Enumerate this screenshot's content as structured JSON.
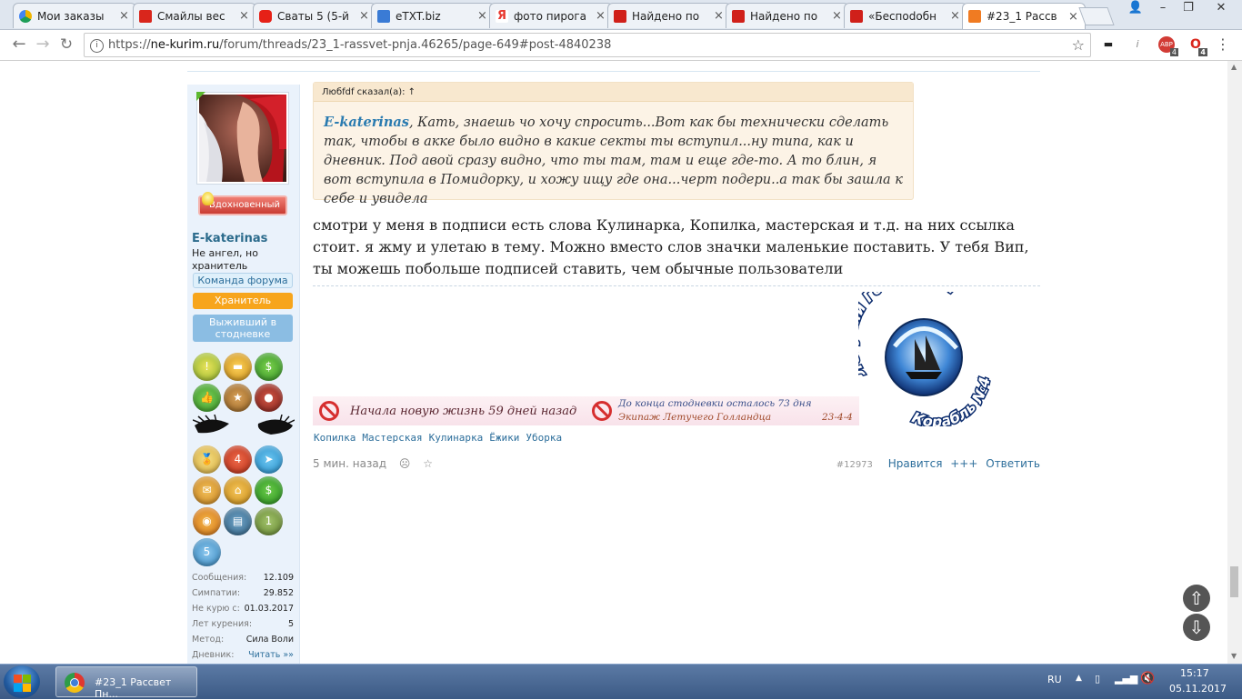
{
  "browser": {
    "tabs": [
      {
        "label": "Мои заказы",
        "color": "#f0a030"
      },
      {
        "label": "Смайлы вес",
        "color": "#d9261c"
      },
      {
        "label": "Сваты 5 (5-й",
        "color": "#e62117"
      },
      {
        "label": "eTXT.biz",
        "color": "#3a7bd5"
      },
      {
        "label": "фото пирога",
        "color": "#e8382f"
      },
      {
        "label": "Найдено по",
        "color": "#d0201a"
      },
      {
        "label": "Найдено по",
        "color": "#d0201a"
      },
      {
        "label": "«Беспodобн",
        "color": "#d0201a"
      },
      {
        "label": "#23_1 Рассв",
        "color": "#f07b22"
      }
    ],
    "url_prefix": "https://",
    "url_host": "ne-kurim.ru",
    "url_path": "/forum/threads/23_1-rassvet-pnja.46265/page-649#post-4840238",
    "ext_badges": [
      "4",
      "4"
    ]
  },
  "user": {
    "rank_badge": "Вдохновенный",
    "username": "E-katerinas",
    "title": "Не ангел, но хранитель",
    "banner_team": "Команда форума",
    "banner_keeper": "Хранитель",
    "banner_survivor": "Выживший в стодневке",
    "trophy_numbers": {
      "t1": "4",
      "t2": "1",
      "t3": "5"
    },
    "stats": [
      {
        "label": "Сообщения:",
        "value": "12.109"
      },
      {
        "label": "Симпатии:",
        "value": "29.852"
      },
      {
        "label": "Не курю с:",
        "value": "01.03.2017"
      },
      {
        "label": "Лет курения:",
        "value": "5"
      },
      {
        "label": "Метод:",
        "value": "Сила Воли"
      },
      {
        "label": "Дневник:",
        "value": "Читать »»"
      }
    ]
  },
  "post": {
    "quote_header": "Любfdf сказал(а): ↑",
    "quote_author": "E-katerinas",
    "quote_text": ", Кать, знаешь чо хочу спросить...Вот как бы технически сделать так, чтобы в акке было видно в какие секты ты вступил...ну типа, как и дневник. Под авой сразу видно, что ты там, там и еще где-то. А то блин, я вот вступила в Помидорку, и хожу ищу где она...черт подери..а так бы зашла к себе и увидела",
    "message": "смотри у меня в подписи есть слова Кулинарка, Копилка, мастерская и т.д. на них ссылка стоит. я жму и улетаю в тему. Можно вместо слов значки маленькие поставить. У тебя Вип, ты можешь побольше подписей ставить, чем обычные пользователи",
    "signature": {
      "banner1": "Начала новую жизнь 59 дней назад",
      "banner2_line1": "До конца стодневки осталось 73 дня",
      "banner2_line2": "Экипаж Летучего Голландца",
      "banner2_code": "23-4-4",
      "logo_top": "Летучий Голландец",
      "logo_bottom": "Корабль №4",
      "links": [
        "Копилка",
        "Мастерская",
        "Кулинарка",
        "Ёжики",
        "Уборка"
      ]
    },
    "time": "5 мин. назад",
    "meta_icons": [
      "☹",
      "☆"
    ],
    "post_number": "#12973",
    "actions": {
      "like": "Нравится",
      "plus": "+++",
      "reply": "Ответить"
    }
  },
  "taskbar": {
    "app_label": "#23_1 Рассвет Пн...",
    "lang": "RU",
    "time": "15:17",
    "date": "05.11.2017"
  }
}
